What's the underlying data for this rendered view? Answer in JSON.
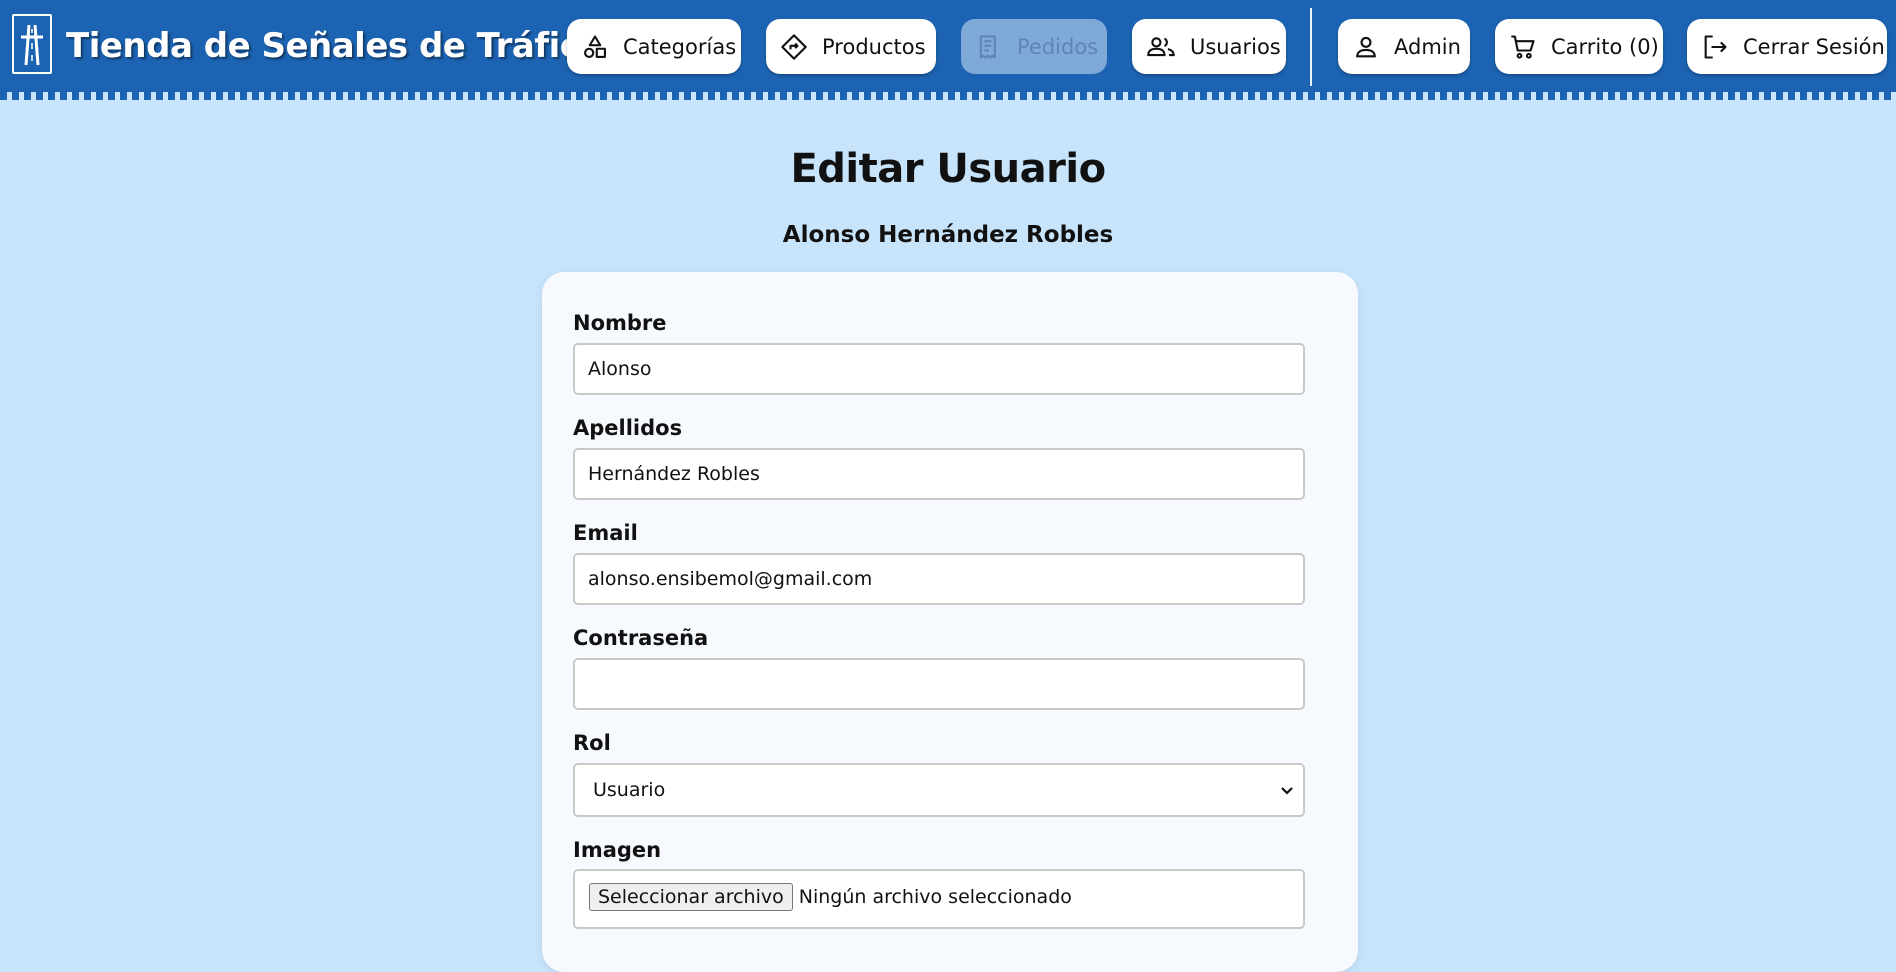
{
  "header": {
    "brand": "Tienda de Señales de Tráfico",
    "accent_color": "#1c64b3",
    "nav": [
      {
        "label": "Categorías",
        "icon": "shapes-icon"
      },
      {
        "label": "Productos",
        "icon": "diamond-sign-icon"
      },
      {
        "label": "Pedidos",
        "icon": "receipt-icon",
        "disabled": true
      },
      {
        "label": "Usuarios",
        "icon": "users-icon"
      }
    ],
    "user_nav": [
      {
        "label": "Admin",
        "icon": "user-icon"
      },
      {
        "label": "Carrito (0)",
        "icon": "cart-icon"
      },
      {
        "label": "Cerrar Sesión",
        "icon": "logout-icon"
      }
    ]
  },
  "page": {
    "title": "Editar Usuario",
    "subtitle": "Alonso Hernández Robles"
  },
  "form": {
    "nombre_label": "Nombre",
    "nombre_value": "Alonso",
    "apellidos_label": "Apellidos",
    "apellidos_value": "Hernández Robles",
    "email_label": "Email",
    "email_value": "alonso.ensibemol@gmail.com",
    "password_label": "Contraseña",
    "password_value": "",
    "rol_label": "Rol",
    "rol_value": "Usuario",
    "imagen_label": "Imagen",
    "file_button": "Seleccionar archivo",
    "file_status": "Ningún archivo seleccionado"
  }
}
